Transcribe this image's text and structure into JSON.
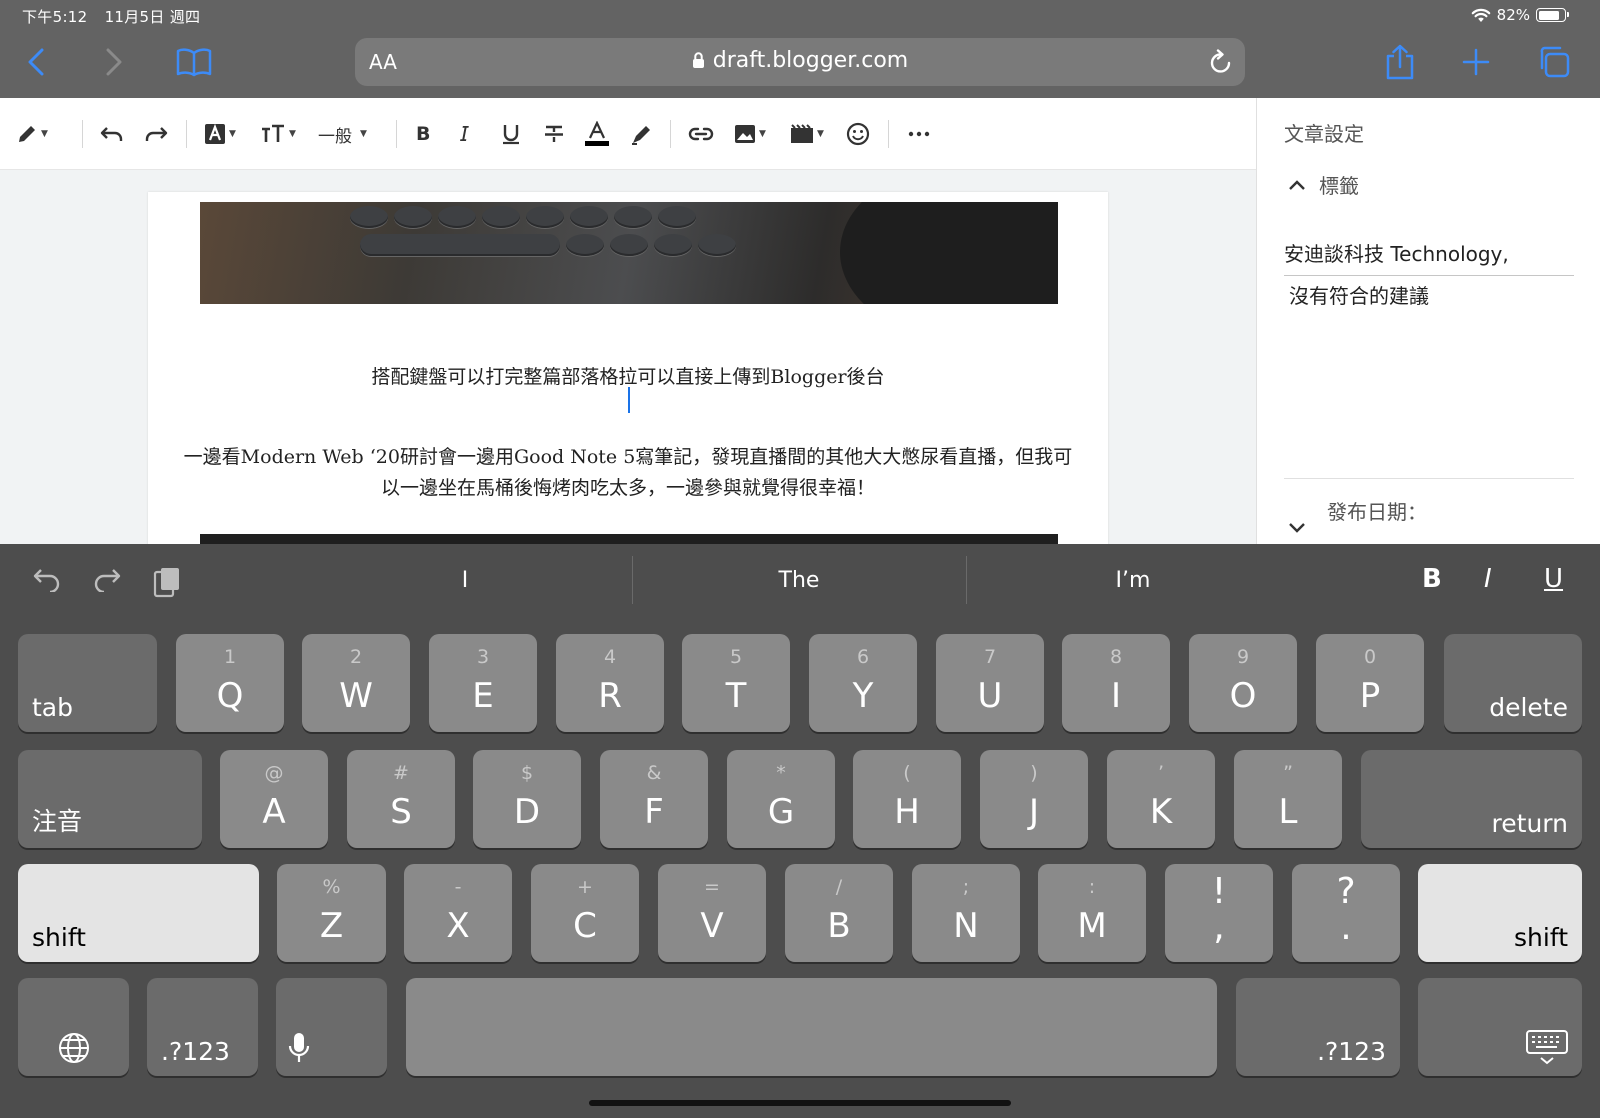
{
  "status_bar": {
    "time": "下午5:12",
    "date": "11月5日 週四",
    "battery": "82%",
    "battery_level": 0.82
  },
  "browser": {
    "text_size_label": "AA",
    "url": "draft.blogger.com"
  },
  "toolbar": {
    "font_style": "一般"
  },
  "post": {
    "caption": "搭配鍵盤可以打完整篇部落格拉可以直接上傳到Blogger後台",
    "paragraph": "一邊看Modern Web ‘20研討會一邊用Good Note 5寫筆記，發現直播間的其他大大憋尿看直播，但我可以一邊坐在馬桶後悔烤肉吃太多，一邊參與就覺得很幸福！"
  },
  "sidebar": {
    "title": "文章設定",
    "labels_heading": "標籤",
    "labels_value": "安迪談科技 Technology,",
    "no_suggestions": "沒有符合的建議",
    "publish_date_label": "發布日期："
  },
  "keyboard": {
    "suggestions": [
      "I",
      "The",
      "I’m"
    ],
    "format_bold": "B",
    "format_italic": "I",
    "format_underline": "U",
    "row1": [
      {
        "main": "Q",
        "alt": "1"
      },
      {
        "main": "W",
        "alt": "2"
      },
      {
        "main": "E",
        "alt": "3"
      },
      {
        "main": "R",
        "alt": "4"
      },
      {
        "main": "T",
        "alt": "5"
      },
      {
        "main": "Y",
        "alt": "6"
      },
      {
        "main": "U",
        "alt": "7"
      },
      {
        "main": "I",
        "alt": "8"
      },
      {
        "main": "O",
        "alt": "9"
      },
      {
        "main": "P",
        "alt": "0"
      }
    ],
    "row2": [
      {
        "main": "A",
        "alt": "@"
      },
      {
        "main": "S",
        "alt": "#"
      },
      {
        "main": "D",
        "alt": "$"
      },
      {
        "main": "F",
        "alt": "&"
      },
      {
        "main": "G",
        "alt": "*"
      },
      {
        "main": "H",
        "alt": "("
      },
      {
        "main": "J",
        "alt": ")"
      },
      {
        "main": "K",
        "alt": "’"
      },
      {
        "main": "L",
        "alt": "”"
      }
    ],
    "row3": [
      {
        "main": "Z",
        "alt": "%"
      },
      {
        "main": "X",
        "alt": "-"
      },
      {
        "main": "C",
        "alt": "+"
      },
      {
        "main": "V",
        "alt": "="
      },
      {
        "main": "B",
        "alt": "/"
      },
      {
        "main": "N",
        "alt": ";"
      },
      {
        "main": "M",
        "alt": ":"
      }
    ],
    "punct_1": {
      "top": "!",
      "bottom": ","
    },
    "punct_2": {
      "top": "?",
      "bottom": "."
    },
    "tab": "tab",
    "delete": "delete",
    "input_mode": "注音",
    "return": "return",
    "shift": "shift",
    "numbers": ".?123"
  }
}
